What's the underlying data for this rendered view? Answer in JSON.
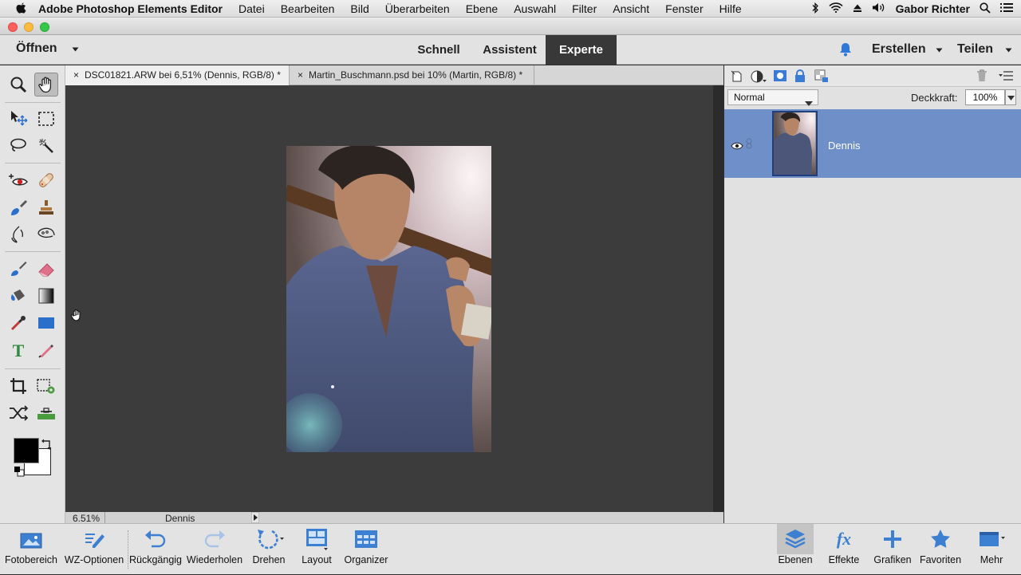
{
  "menubar": {
    "app_name": "Adobe Photoshop Elements Editor",
    "items": [
      "Datei",
      "Bearbeiten",
      "Bild",
      "Überarbeiten",
      "Ebene",
      "Auswahl",
      "Filter",
      "Ansicht",
      "Fenster",
      "Hilfe"
    ],
    "user": "Gabor Richter"
  },
  "header": {
    "open_label": "Öffnen",
    "modes": [
      "Schnell",
      "Assistent",
      "Experte"
    ],
    "active_mode": "Experte",
    "create_label": "Erstellen",
    "share_label": "Teilen"
  },
  "documents": {
    "tabs": [
      {
        "close": "×",
        "title": "DSC01821.ARW bei 6,51% (Dennis, RGB/8) *"
      },
      {
        "close": "×",
        "title": "Martin_Buschmann.psd bei 10% (Martin, RGB/8) *"
      }
    ]
  },
  "status": {
    "zoom": "6.51%",
    "layer": "Dennis"
  },
  "layers_panel": {
    "blend_mode": "Normal",
    "opacity_label": "Deckkraft:",
    "opacity_value": "100%",
    "layer_name": "Dennis"
  },
  "bottom_bar": {
    "items": [
      "Fotobereich",
      "WZ-Optionen",
      "Rückgängig",
      "Wiederholen",
      "Drehen",
      "Layout",
      "Organizer"
    ],
    "right_items": [
      "Ebenen",
      "Effekte",
      "Grafiken",
      "Favoriten",
      "Mehr"
    ]
  },
  "colors": {
    "accent_blue": "#6f8fc8",
    "canvas": "#3c3c3c",
    "active_tab": "#383838"
  }
}
